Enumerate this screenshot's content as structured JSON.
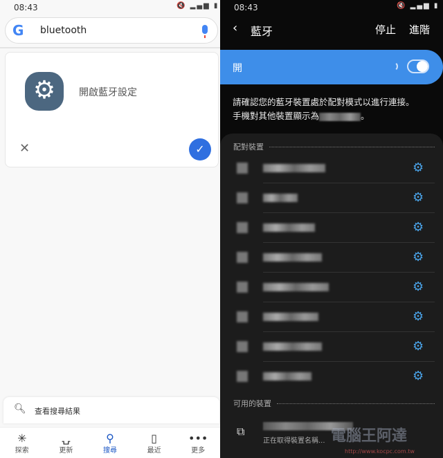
{
  "left": {
    "status_time": "08:43",
    "search": {
      "logo": "G",
      "query": "bluetooth"
    },
    "card": {
      "title": "開啟藍牙設定",
      "icon": "settings-gear-icon"
    },
    "results_label": "查看搜尋結果",
    "nav": [
      {
        "label": "探索",
        "icon": "asterisk-icon"
      },
      {
        "label": "更新",
        "icon": "updates-icon"
      },
      {
        "label": "搜尋",
        "icon": "search-icon",
        "active": true
      },
      {
        "label": "最近",
        "icon": "recent-icon"
      },
      {
        "label": "更多",
        "icon": "more-icon"
      }
    ],
    "accent": "#1a56c4"
  },
  "right": {
    "status_time": "08:43",
    "title": "藍牙",
    "stop": "停止",
    "advanced": "進階",
    "toggle_label": "開",
    "toggle_on": true,
    "desc_line1": "請確認您的藍牙裝置處於配對模式以進行連接。",
    "desc_line2_prefix": "手機對其他裝置顯示為",
    "desc_line2_suffix": "。",
    "paired_header": "配對裝置",
    "available_header": "可用的裝置",
    "available_status": "正在取得裝置名稱...",
    "accent": "#3e8ee9"
  },
  "watermark": {
    "text": "電腦王阿達",
    "url": "http://www.kocpc.com.tw"
  }
}
